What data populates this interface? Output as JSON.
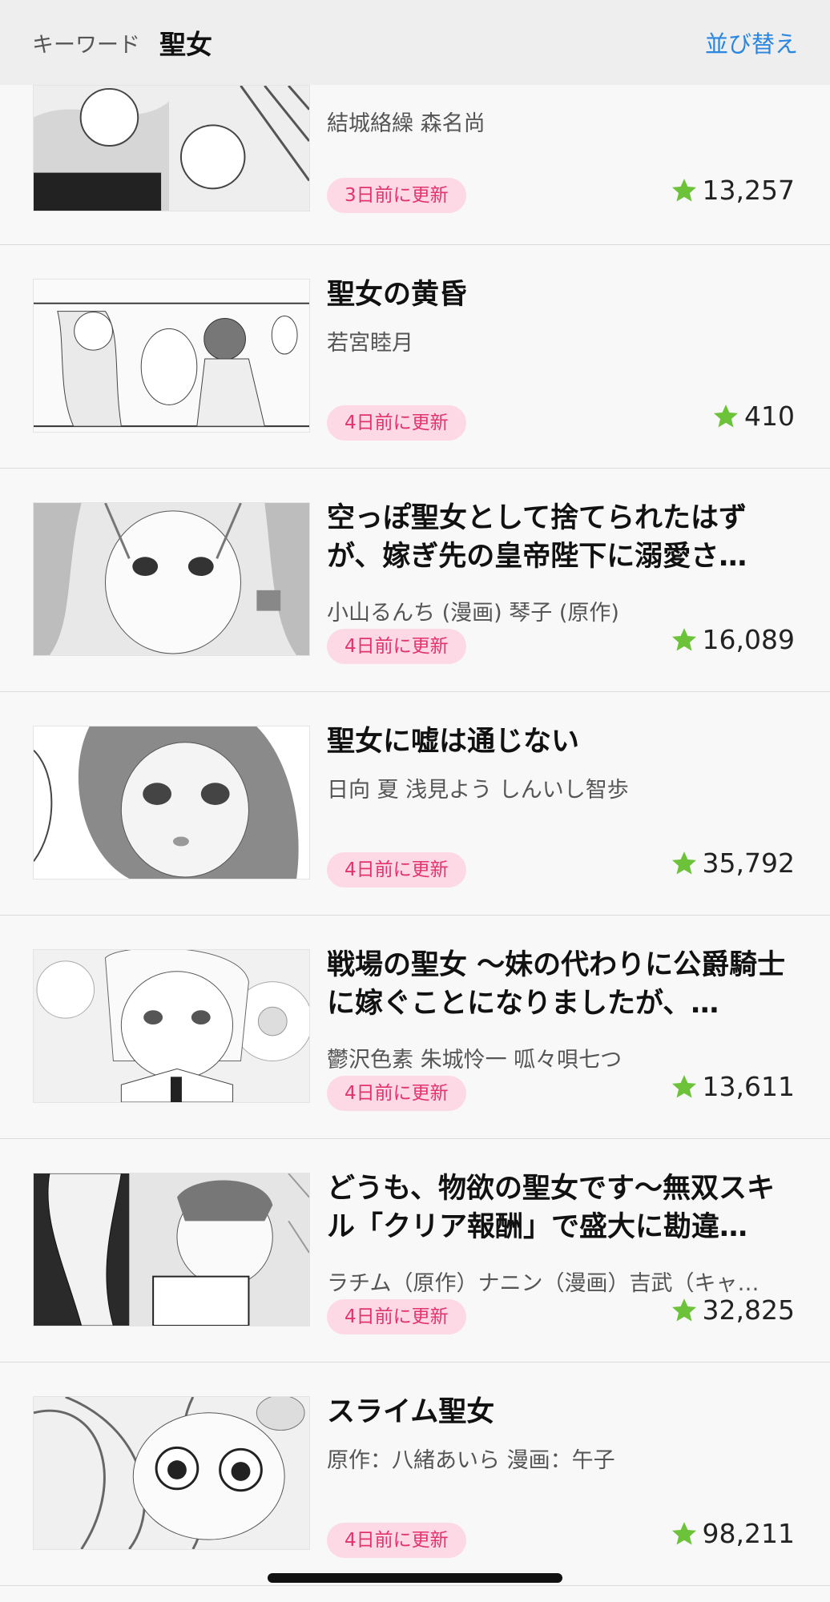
{
  "header": {
    "keyword_label": "キーワード",
    "keyword_value": "聖女",
    "sort_label": "並び替え"
  },
  "items": [
    {
      "title": "",
      "author": "結城絡繰 森名尚",
      "badge": "3日前に更新",
      "rating": "13,257"
    },
    {
      "title": "聖女の黄昏",
      "author": "若宮睦月",
      "badge": "4日前に更新",
      "rating": "410"
    },
    {
      "title": "空っぽ聖女として捨てられたはずが、嫁ぎ先の皇帝陛下に溺愛さ…",
      "author": "小山るんち (漫画) 琴子 (原作)",
      "badge": "4日前に更新",
      "rating": "16,089"
    },
    {
      "title": "聖女に嘘は通じない",
      "author": "日向 夏 浅見よう しんいし智歩",
      "badge": "4日前に更新",
      "rating": "35,792"
    },
    {
      "title": "戦場の聖女 〜妹の代わりに公爵騎士に嫁ぐことになりましたが、…",
      "author": "鬱沢色素 朱城怜一 呱々唄七つ",
      "badge": "4日前に更新",
      "rating": "13,611"
    },
    {
      "title": "どうも、物欲の聖女です〜無双スキル「クリア報酬」で盛大に勘違…",
      "author": "ラチム（原作）ナニン（漫画）吉武（キャ…",
      "badge": "4日前に更新",
      "rating": "32,825"
    },
    {
      "title": "スライム聖女",
      "author": "原作：八緒あいら 漫画：午子",
      "badge": "4日前に更新",
      "rating": "98,211"
    }
  ],
  "colors": {
    "star": "#6cc33a",
    "badge_bg": "#fcd9e5",
    "badge_text": "#e23370",
    "accent": "#2a86e0"
  }
}
